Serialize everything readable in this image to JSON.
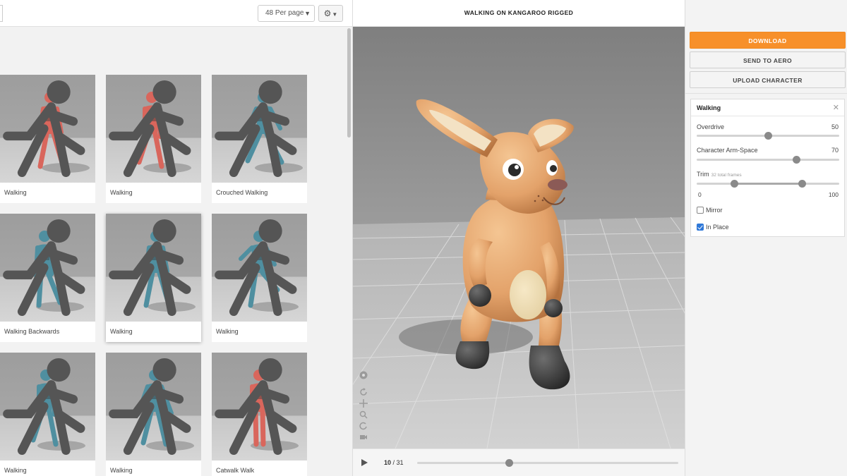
{
  "toolbar": {
    "per_page": "48 Per page",
    "settings_icon": "gear-icon"
  },
  "animations": [
    {
      "label": "Walking",
      "figure": "red",
      "pose": "walk-a",
      "selected": false
    },
    {
      "label": "Walking",
      "figure": "red",
      "pose": "walk-b",
      "selected": false
    },
    {
      "label": "Crouched Walking",
      "figure": "teal",
      "pose": "crouch",
      "selected": false
    },
    {
      "label": "Walking Backwards",
      "figure": "teal",
      "pose": "walk-back",
      "selected": false
    },
    {
      "label": "Walking",
      "figure": "teal",
      "pose": "walk-a",
      "selected": true
    },
    {
      "label": "Walking",
      "figure": "teal",
      "pose": "high-knee",
      "selected": false
    },
    {
      "label": "Walking",
      "figure": "teal",
      "pose": "walk-b",
      "selected": false
    },
    {
      "label": "Walking",
      "figure": "teal",
      "pose": "walk-arms",
      "selected": false
    },
    {
      "label": "Catwalk Walk",
      "figure": "red",
      "pose": "catwalk",
      "selected": false
    }
  ],
  "figure_colors": {
    "red": "#d9665c",
    "teal": "#4f8fa0"
  },
  "viewer": {
    "title": "WALKING ON KANGAROO RIGGED",
    "current_frame": "10",
    "total_frames": "31",
    "progress": 0.35,
    "tools": [
      "eye-icon",
      "rotate-icon",
      "move-icon",
      "zoom-icon",
      "reset-icon",
      "camera-icon"
    ]
  },
  "actions": {
    "download": "DOWNLOAD",
    "send_to_aero": "SEND TO AERO",
    "upload_character": "UPLOAD CHARACTER"
  },
  "accent_color": "#f7902a",
  "params": {
    "title": "Walking",
    "overdrive": {
      "label": "Overdrive",
      "value": "50",
      "fraction": 0.5
    },
    "arm_space": {
      "label": "Character Arm-Space",
      "value": "70",
      "fraction": 0.7
    },
    "trim": {
      "label": "Trim",
      "hint": "32 total frames",
      "min_label": "0",
      "max_label": "100",
      "start": 0.26,
      "end": 0.74
    },
    "mirror": {
      "label": "Mirror",
      "checked": false
    },
    "in_place": {
      "label": "In Place",
      "checked": true
    }
  }
}
